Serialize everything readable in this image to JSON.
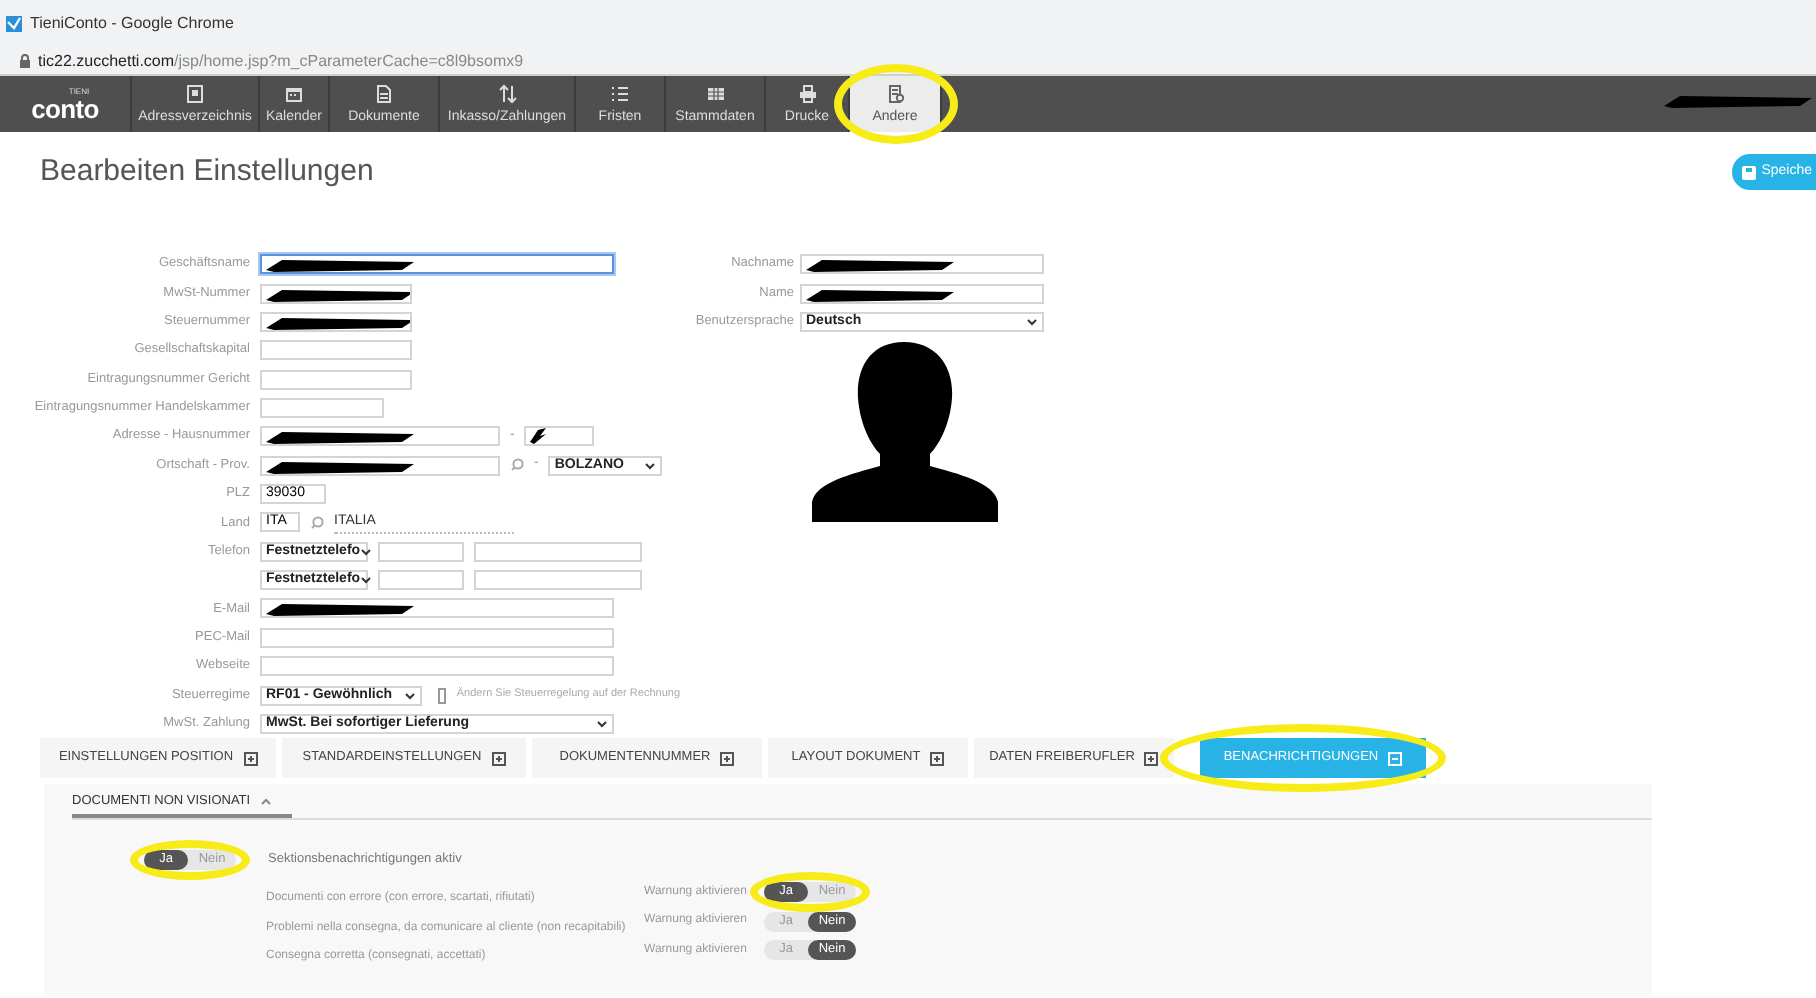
{
  "window": {
    "title": "TieniConto - Google Chrome"
  },
  "address_bar": {
    "domain": "tic22.zucchetti.com",
    "path": "/jsp/home.jsp?m_cParameterCache=c8l9bsomx9"
  },
  "nav": {
    "logo": "conto",
    "logo_small": "TIENI",
    "user_redacted": true,
    "items": [
      {
        "label": "Adressverzeichnis",
        "selected": false,
        "highlighted": false
      },
      {
        "label": "Kalender",
        "selected": false,
        "highlighted": false
      },
      {
        "label": "Dokumente",
        "selected": false,
        "highlighted": false
      },
      {
        "label": "Inkasso/Zahlungen",
        "selected": false,
        "highlighted": false
      },
      {
        "label": "Fristen",
        "selected": false,
        "highlighted": false
      },
      {
        "label": "Stammdaten",
        "selected": false,
        "highlighted": false
      },
      {
        "label": "Drucke",
        "selected": false,
        "highlighted": false
      },
      {
        "label": "Andere",
        "selected": true,
        "highlighted": true
      }
    ]
  },
  "page": {
    "title": "Bearbeiten Einstellungen",
    "save_button": "Speiche"
  },
  "form_left": [
    {
      "kind": "text",
      "label": "Geschäftsname",
      "redacted": true,
      "focused": true
    },
    {
      "kind": "text",
      "label": "MwSt-Nummer",
      "redacted": true
    },
    {
      "kind": "text",
      "label": "Steuernummer",
      "redacted": true
    },
    {
      "kind": "text",
      "label": "Gesellschaftskapital"
    },
    {
      "kind": "text",
      "label": "Eintragungsnummer Gericht"
    },
    {
      "kind": "text",
      "label": "Eintragungsnummer Handelskammer"
    },
    {
      "kind": "address",
      "label": "Adresse - Hausnummer",
      "separator": "-",
      "redacted": true
    },
    {
      "kind": "place",
      "label": "Ortschaft - Prov.",
      "separator": "-",
      "redacted": true,
      "province": "BOLZANO"
    },
    {
      "kind": "text",
      "label": "PLZ",
      "value": "39030"
    },
    {
      "kind": "country",
      "label": "Land",
      "code": "ITA",
      "name": "ITALIA"
    },
    {
      "kind": "phone",
      "label": "Telefon",
      "type": "Festnetztelefo"
    },
    {
      "kind": "phone",
      "type": "Festnetztelefo"
    },
    {
      "kind": "text",
      "label": "E-Mail",
      "redacted": true
    },
    {
      "kind": "text",
      "label": "PEC-Mail"
    },
    {
      "kind": "text",
      "label": "Webseite"
    },
    {
      "kind": "select_check",
      "label": "Steuerregime",
      "value": "RF01 - Gewöhnlich",
      "check_label": "Ändern Sie Steuerregelung auf der Rechnung",
      "checked": false
    },
    {
      "kind": "select",
      "label": "MwSt. Zahlung",
      "value": "MwSt. Bei sofortiger Lieferung"
    }
  ],
  "form_right": [
    {
      "kind": "text",
      "label": "Nachname",
      "redacted": true
    },
    {
      "kind": "text",
      "label": "Name",
      "redacted": true
    },
    {
      "kind": "select",
      "label": "Benutzersprache",
      "value": "Deutsch"
    }
  ],
  "tabs": [
    {
      "label": "EINSTELLUNGEN POSITION",
      "selected": false,
      "highlighted": false
    },
    {
      "label": "STANDARDEINSTELLUNGEN",
      "selected": false,
      "highlighted": false
    },
    {
      "label": "DOKUMENTENNUMMER",
      "selected": false,
      "highlighted": false
    },
    {
      "label": "LAYOUT DOKUMENT",
      "selected": false,
      "highlighted": false
    },
    {
      "label": "DATEN FREIBERUFLER",
      "selected": false,
      "highlighted": false
    },
    {
      "label": "BENACHRICHTIGUNGEN",
      "selected": true,
      "highlighted": true
    }
  ],
  "subtab": {
    "label": "DOCUMENTI NON VISIONATI",
    "expanded": true
  },
  "section_toggle": {
    "label": "Sektionsbenachrichtigungen aktiv",
    "yes": "Ja",
    "no": "Nein",
    "on": true,
    "highlighted": true
  },
  "notifications": [
    {
      "label": "Documenti con errore (con errore, scartati, rifiutati)",
      "warning_label": "Warnung aktivieren",
      "yes": "Ja",
      "no": "Nein",
      "on": true,
      "highlighted": true
    },
    {
      "label": "Problemi nella consegna, da comunicare al cliente (non recapitabili)",
      "warning_label": "Warnung aktivieren",
      "yes": "Ja",
      "no": "Nein",
      "on": false,
      "highlighted": false
    },
    {
      "label": "Consegna corretta (consegnati, accettati)",
      "warning_label": "Warnung aktivieren",
      "yes": "Ja",
      "no": "Nein",
      "on": false,
      "highlighted": false
    }
  ]
}
